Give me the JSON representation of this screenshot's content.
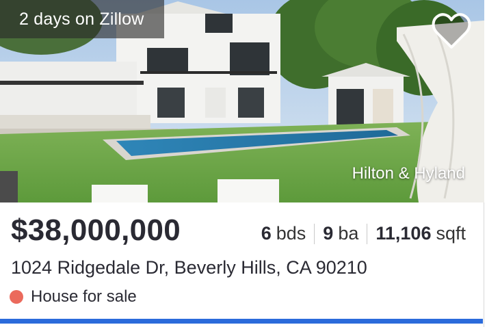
{
  "listing": {
    "days_on_site": "2 days on Zillow",
    "brokerage": "Hilton & Hyland",
    "price": "$38,000,000",
    "beds": {
      "value": "6",
      "unit": "bds"
    },
    "baths": {
      "value": "9",
      "unit": "ba"
    },
    "sqft": {
      "value": "11,106",
      "unit": "sqft"
    },
    "address": "1024 Ridgedale Dr, Beverly Hills, CA 90210",
    "status": "House for sale",
    "favorite_icon": "heart-outline-icon",
    "saved": false
  },
  "colors": {
    "status_dot": "#eb6a5c",
    "accent_bar": "#2b6bdb",
    "text": "#2a2a33"
  }
}
